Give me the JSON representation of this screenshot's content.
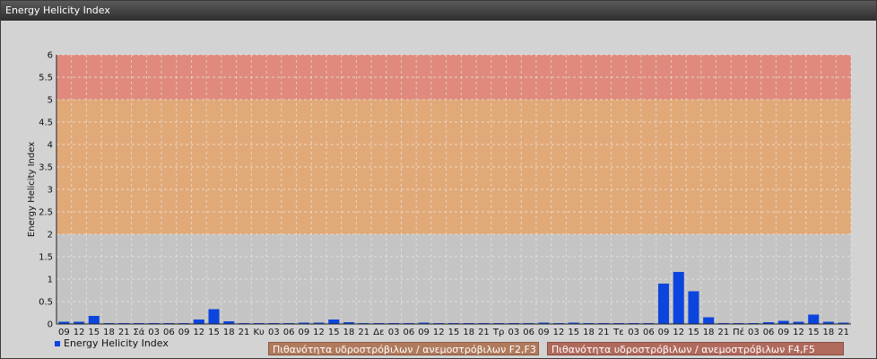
{
  "window": {
    "title": "Energy Helicity Index"
  },
  "legend": {
    "series_label": "Energy Helicity Index"
  },
  "bands": [
    {
      "label": "Πιθανότητα υδροστρόβιλων / ανεμοστρόβιλων F2,F3",
      "from": 2,
      "to": 5,
      "color": "#e6a46b"
    },
    {
      "label": "Πιθανότητα υδροστρόβιλων / ανεμοστρόβιλων F4,F5",
      "from": 5,
      "to": 6,
      "color": "#e48070"
    }
  ],
  "colors": {
    "bar": "#0b45dd",
    "plot_bg": "#c4c4c4",
    "grid": "#eeeeee"
  },
  "chart_data": {
    "type": "bar",
    "ylabel": "Energy Helicity Index",
    "ylim": [
      0,
      6
    ],
    "yticks": [
      "0",
      "0.5",
      "1",
      "1.5",
      "2",
      "2.5",
      "3",
      "3.5",
      "4",
      "4.5",
      "5",
      "5.5",
      "6"
    ],
    "grid": true,
    "legend_position": "bottom-left",
    "categories": [
      "09",
      "12",
      "15",
      "18",
      "21",
      "Σά",
      "03",
      "06",
      "09",
      "12",
      "15",
      "18",
      "21",
      "Κυ",
      "03",
      "06",
      "09",
      "12",
      "15",
      "18",
      "21",
      "Δε",
      "03",
      "06",
      "09",
      "12",
      "15",
      "18",
      "21",
      "Τρ",
      "03",
      "06",
      "09",
      "12",
      "15",
      "18",
      "21",
      "Τε",
      "03",
      "06",
      "09",
      "12",
      "15",
      "18",
      "21",
      "Πέ",
      "03",
      "06",
      "09",
      "12",
      "15",
      "18",
      "21"
    ],
    "series": [
      {
        "name": "Energy Helicity Index",
        "values": [
          0.05,
          0.05,
          0.18,
          0.02,
          0.02,
          0.02,
          0.02,
          0.02,
          0.02,
          0.1,
          0.33,
          0.06,
          0.02,
          0.02,
          0.02,
          0.02,
          0.03,
          0.03,
          0.1,
          0.04,
          0.02,
          0.02,
          0.02,
          0.02,
          0.03,
          0.02,
          0.02,
          0.02,
          0.02,
          0.02,
          0.02,
          0.02,
          0.03,
          0.02,
          0.03,
          0.02,
          0.02,
          0.02,
          0.02,
          0.02,
          0.9,
          1.16,
          0.73,
          0.15,
          0.02,
          0.02,
          0.02,
          0.04,
          0.07,
          0.05,
          0.21,
          0.05,
          0.03
        ]
      }
    ]
  }
}
